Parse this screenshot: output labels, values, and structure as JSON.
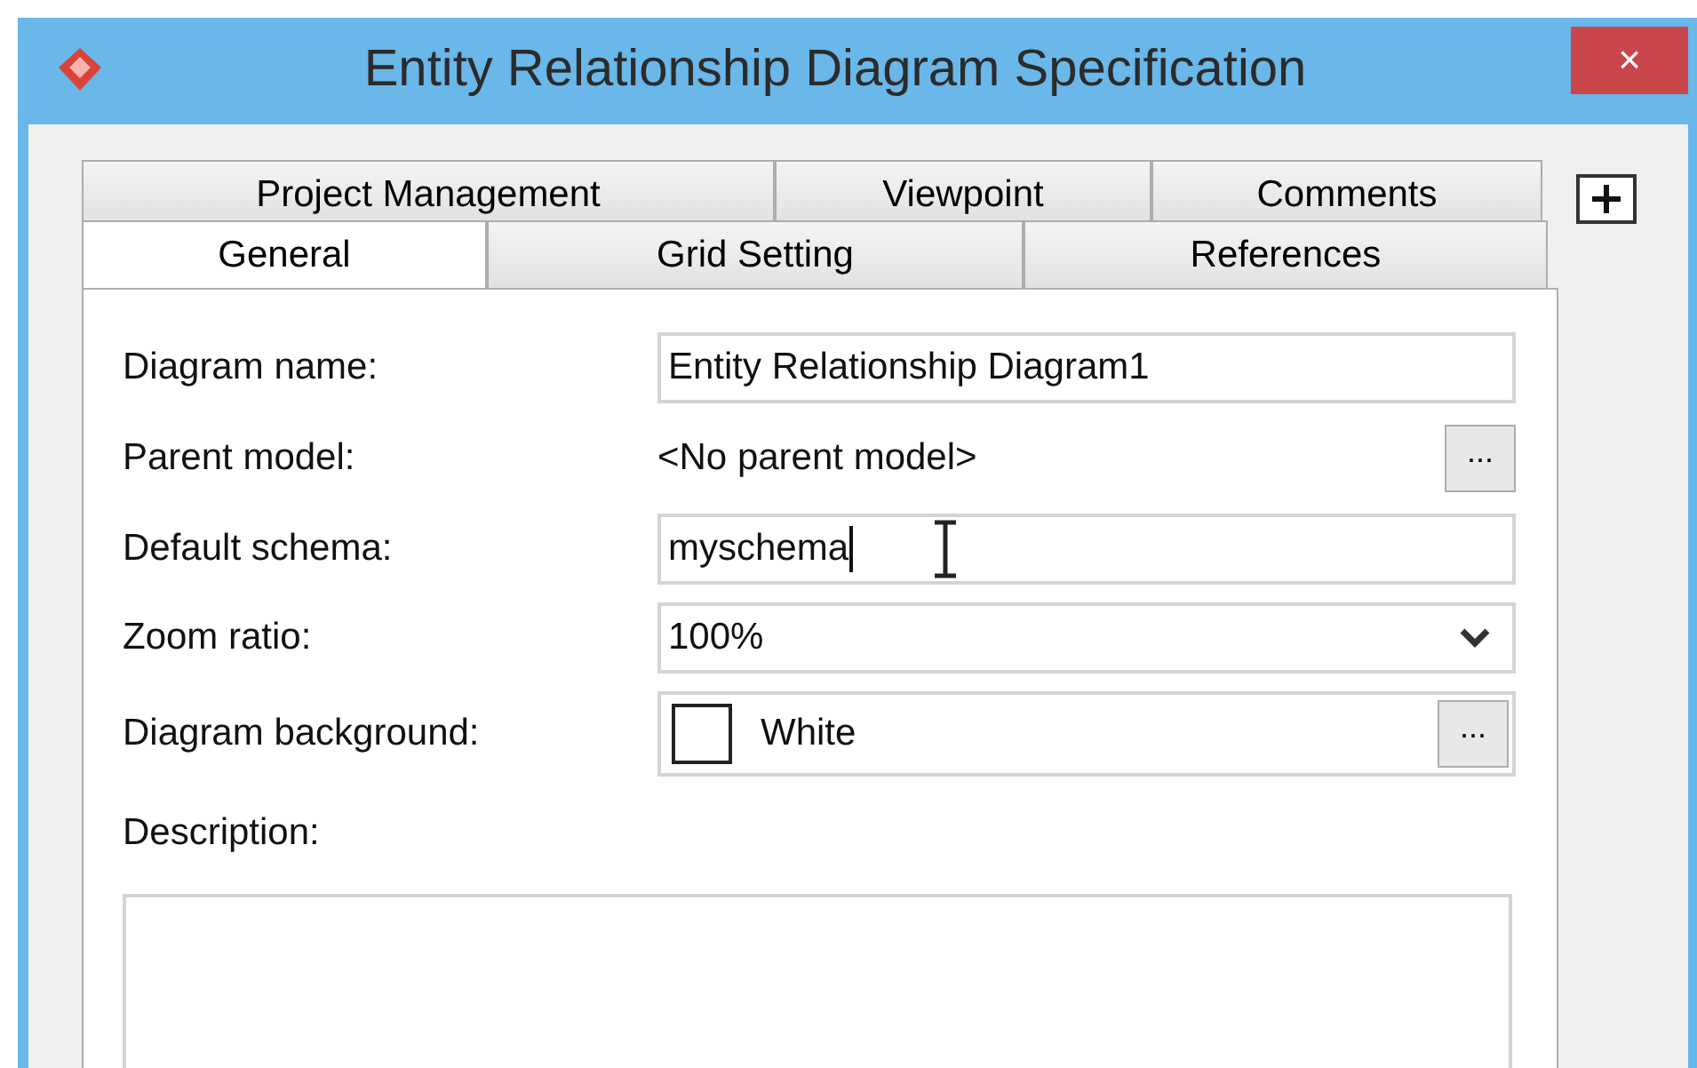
{
  "window": {
    "title": "Entity Relationship Diagram Specification",
    "close": "×"
  },
  "tab_rows": [
    {
      "tabs": [
        {
          "label": "Project Management",
          "selected": false
        },
        {
          "label": "Viewpoint",
          "selected": false
        },
        {
          "label": "Comments",
          "selected": false
        }
      ]
    },
    {
      "tabs": [
        {
          "label": "General",
          "selected": true
        },
        {
          "label": "Grid Setting",
          "selected": false
        },
        {
          "label": "References",
          "selected": false
        }
      ]
    }
  ],
  "fields": [
    {
      "kind": "text",
      "label": "Diagram name:",
      "value": "Entity Relationship Diagram1",
      "focused": false
    },
    {
      "kind": "static",
      "label": "Parent model:",
      "value": "<No parent model>",
      "button": "..."
    },
    {
      "kind": "text",
      "label": "Default schema:",
      "value": "myschema",
      "focused": true
    },
    {
      "kind": "select",
      "label": "Zoom ratio:",
      "value": "100%"
    },
    {
      "kind": "color",
      "label": "Diagram background:",
      "value": "White",
      "color": "#ffffff",
      "button": "..."
    }
  ],
  "description": {
    "label": "Description:"
  }
}
